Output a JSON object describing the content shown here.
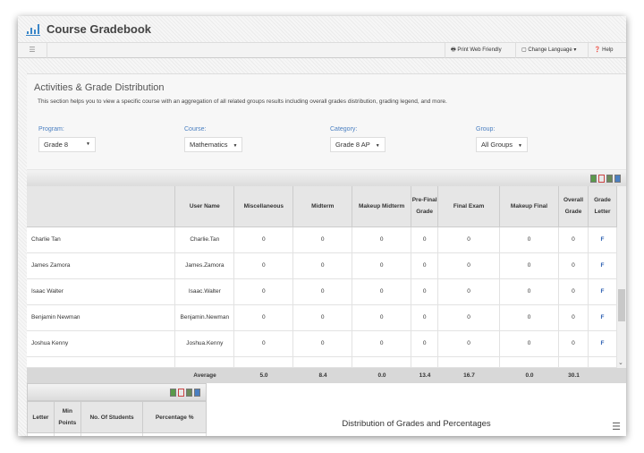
{
  "app": {
    "title": "Course Gradebook"
  },
  "toolbar": {
    "print": "Print Web Friendly",
    "language": "Change Language",
    "help": "Help"
  },
  "section": {
    "title": "Activities & Grade Distribution",
    "description": "This section helps you to view a specific course with an aggregation of all related groups results including overall grades distribution, grading legend, and more."
  },
  "filters": [
    {
      "label": "Program:",
      "value": "Grade 8"
    },
    {
      "label": "Course:",
      "value": "Mathematics"
    },
    {
      "label": "Category:",
      "value": "Grade 8 AP"
    },
    {
      "label": "Group:",
      "value": "All Groups"
    }
  ],
  "table": {
    "headers": [
      "",
      "User Name",
      "Miscellaneous",
      "Midterm",
      "Makeup Midterm",
      "Pre-Final Grade",
      "Final Exam",
      "Makeup Final",
      "Overall Grade",
      "Grade Letter"
    ],
    "rows": [
      [
        "Charlie Tan",
        "Charlie.Tan",
        "0",
        "0",
        "0",
        "0",
        "0",
        "0",
        "0",
        "F"
      ],
      [
        "James Zamora",
        "James.Zamora",
        "0",
        "0",
        "0",
        "0",
        "0",
        "0",
        "0",
        "F"
      ],
      [
        "Isaac Walter",
        "Isaac.Walter",
        "0",
        "0",
        "0",
        "0",
        "0",
        "0",
        "0",
        "F"
      ],
      [
        "Benjamin Newman",
        "Benjamin.Newman",
        "0",
        "0",
        "0",
        "0",
        "0",
        "0",
        "0",
        "F"
      ],
      [
        "Joshua Kenny",
        "Joshua.Kenny",
        "0",
        "0",
        "0",
        "0",
        "0",
        "0",
        "0",
        "F"
      ]
    ],
    "average": {
      "label": "Average",
      "values": [
        "5.0",
        "8.4",
        "0.0",
        "13.4",
        "16.7",
        "0.0",
        "30.1"
      ]
    }
  },
  "legend_table": {
    "headers": [
      "Letter",
      "Min Points",
      "No. Of Students",
      "Percentage %"
    ]
  },
  "chart": {
    "title": "Distribution of Grades and Percentages"
  }
}
